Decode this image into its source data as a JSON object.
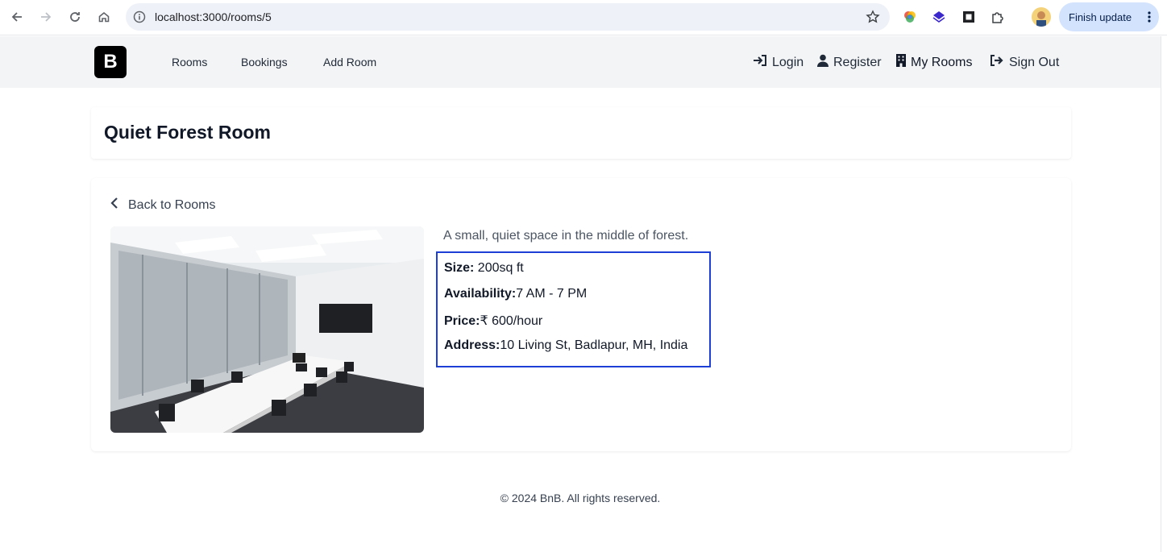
{
  "browser": {
    "url": "localhost:3000/rooms/5",
    "finish_update_label": "Finish update"
  },
  "header": {
    "logo_letter": "B",
    "nav": [
      "Rooms",
      "Bookings",
      "Add Room"
    ],
    "login_label": "Login",
    "register_label": "Register",
    "my_rooms_label": "My Rooms",
    "sign_out_label": "Sign Out"
  },
  "room": {
    "title": "Quiet Forest Room",
    "back_label": "Back to Rooms",
    "description": "A small, quiet space in the middle of forest.",
    "size_label": "Size:",
    "size_value": " 200sq ft",
    "availability_label": "Availability:",
    "availability_value": "7 AM - 7 PM",
    "price_label": "Price:",
    "price_value": "₹ 600/hour",
    "address_label": "Address:",
    "address_value": "10 Living St, Badlapur, MH, India"
  },
  "footer": {
    "text": "© 2024 BnB. All rights reserved."
  },
  "colors": {
    "header_bg": "#f3f4f6",
    "highlight_border": "#1d3fd6"
  }
}
